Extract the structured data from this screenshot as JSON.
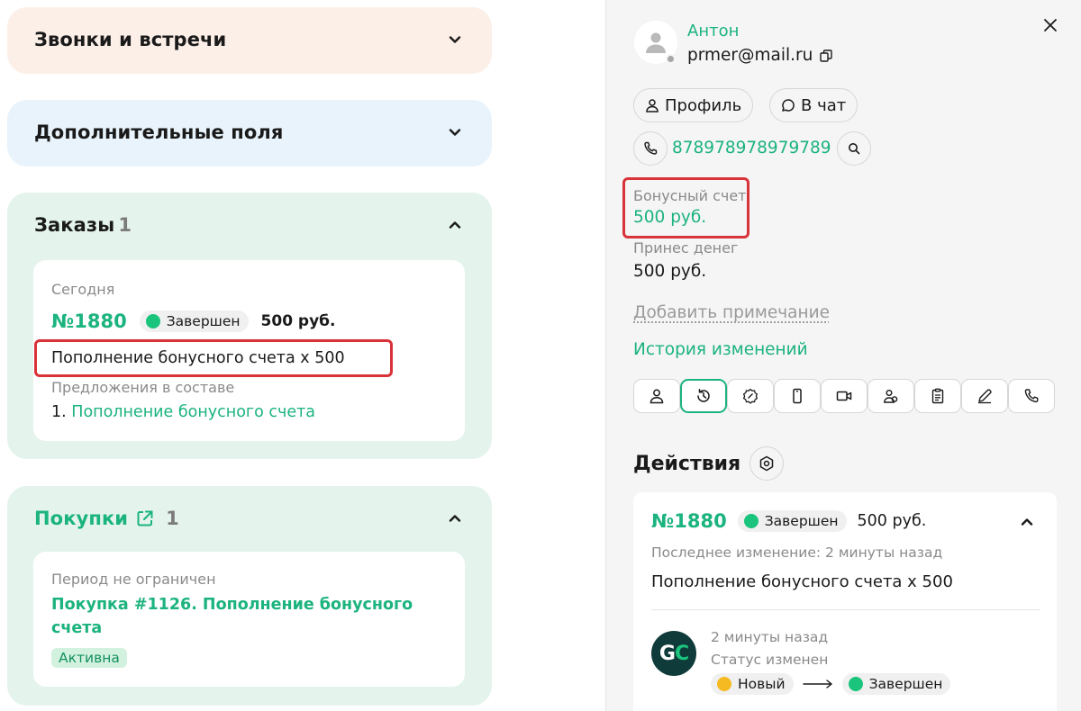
{
  "left": {
    "calls_title": "Звонки и встречи",
    "extra_title": "Дополнительные поля",
    "orders": {
      "title": "Заказы",
      "count": "1",
      "date_label": "Сегодня",
      "number": "№1880",
      "status": "Завершен",
      "price": "500 руб.",
      "description": "Пополнение бонусного счета x 500",
      "offers_label": "Предложения в составе",
      "offer_index": "1.",
      "offer_link": "Пополнение бонусного счета"
    },
    "purchases": {
      "title": "Покупки",
      "count": "1",
      "period": "Период не ограничен",
      "link_line1": "Покупка #1126. Пополнение бонусного",
      "link_line2": "счета",
      "badge": "Активна"
    }
  },
  "contact": {
    "name": "Антон",
    "email": "prmer@mail.ru",
    "profile_button": "Профиль",
    "chat_button": "В чат",
    "phone": "878978978979789",
    "bonus_label": "Бонусный счет",
    "bonus_value": "500 руб.",
    "money_label": "Принес денег",
    "money_value": "500 руб.",
    "add_note": "Добавить примечание",
    "history": "История изменений"
  },
  "actions": {
    "title": "Действия",
    "order_number": "№1880",
    "status": "Завершен",
    "price": "500 руб.",
    "last_change": "Последнее изменение: 2 минуты назад",
    "description": "Пополнение бонусного счета x 500",
    "event_time": "2 минуты назад",
    "event_title": "Статус изменен",
    "from_status": "Новый",
    "to_status": "Завершен",
    "avatar_g": "G",
    "avatar_c": "C"
  },
  "colors": {
    "accent": "#1bb37e",
    "highlight": "#d9333a"
  }
}
